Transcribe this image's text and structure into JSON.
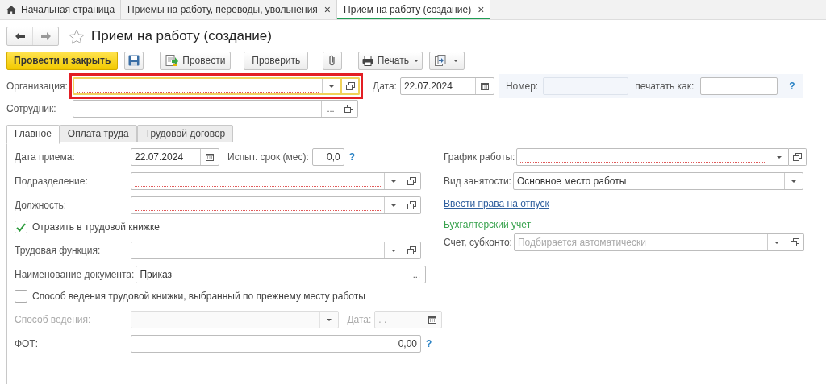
{
  "window_tabs": [
    {
      "label": "Начальная страница",
      "home": true,
      "selected": false
    },
    {
      "label": "Приемы на работу, переводы, увольнения",
      "close": "×",
      "selected": false
    },
    {
      "label": "Прием на работу (создание)",
      "close": "×",
      "selected": true
    }
  ],
  "title": "Прием на работу (создание)",
  "favorite": false,
  "toolbar": [
    {
      "kind": "primary",
      "label": "Провести и закрыть"
    },
    {
      "kind": "save"
    },
    {
      "kind": "post",
      "label": "Провести"
    },
    {
      "kind": "plain",
      "label": "Проверить"
    },
    {
      "kind": "attach"
    },
    {
      "kind": "print",
      "label": "Печать",
      "dropdown": true
    },
    {
      "kind": "more",
      "dropdown": true
    }
  ],
  "organization": {
    "label": "Организация:",
    "kind": "select",
    "required": true,
    "open_button": true,
    "focused": true,
    "highlighted": true
  },
  "date": {
    "label": "Дата:",
    "kind": "date",
    "value": "22.07.2024"
  },
  "number": {
    "label": "Номер:",
    "disabled": true
  },
  "print_as": {
    "label": "печатать как:",
    "help": "?"
  },
  "employee": {
    "label": "Сотрудник:",
    "kind": "choice",
    "button_text": "...",
    "required": true,
    "open_button": true
  },
  "form_tabs": [
    {
      "label": "Главное",
      "selected": true
    },
    {
      "label": "Оплата труда",
      "selected": false
    },
    {
      "label": "Трудовой договор",
      "selected": false
    }
  ],
  "left_rows": [
    {
      "kind": "field",
      "label": "Дата приема:",
      "field": {
        "kind": "date",
        "value": "22.07.2024"
      },
      "extra": {
        "label": "Испыт. срок (мес):",
        "field": {
          "kind": "number",
          "value": "0,0"
        },
        "help": "?"
      }
    },
    {
      "kind": "field",
      "label": "Подразделение:",
      "field": {
        "kind": "select",
        "required": true,
        "open_button": true
      }
    },
    {
      "kind": "field",
      "label": "Должность:",
      "field": {
        "kind": "select",
        "required": true,
        "open_button": true
      }
    },
    {
      "kind": "checkbox",
      "label": "Отразить в трудовой книжке",
      "checked": true
    },
    {
      "kind": "field",
      "label": "Трудовая функция:",
      "field": {
        "kind": "select",
        "open_button": true
      }
    },
    {
      "kind": "field",
      "label": "Наименование документа:",
      "field": {
        "kind": "choice",
        "value": "Приказ",
        "button_text": "..."
      }
    },
    {
      "kind": "checkbox",
      "label": "Способ ведения трудовой книжки, выбранный по прежнему месту работы",
      "checked": false
    },
    {
      "kind": "field",
      "label": "Способ ведения:",
      "disabled": true,
      "field": {
        "kind": "select",
        "disabled": true
      },
      "extra": {
        "label": "Дата:",
        "field": {
          "kind": "date",
          "placeholder": " .  .",
          "disabled": true
        }
      }
    },
    {
      "kind": "field",
      "label": "ФОТ:",
      "field": {
        "kind": "number",
        "value": "0,00"
      },
      "help": "?"
    }
  ],
  "right_rows": [
    {
      "kind": "field",
      "label": "График работы:",
      "field": {
        "kind": "select",
        "required": true,
        "open_button": true
      }
    },
    {
      "kind": "field",
      "label": "Вид занятости:",
      "field": {
        "kind": "select",
        "value": "Основное место работы"
      }
    },
    {
      "kind": "link",
      "label": "Ввести права на отпуск"
    },
    {
      "kind": "heading",
      "label": "Бухгалтерский учет"
    },
    {
      "kind": "field",
      "label": "Счет, субконто:",
      "field": {
        "kind": "select",
        "placeholder": "Подбирается автоматически",
        "open_button": true
      }
    }
  ]
}
